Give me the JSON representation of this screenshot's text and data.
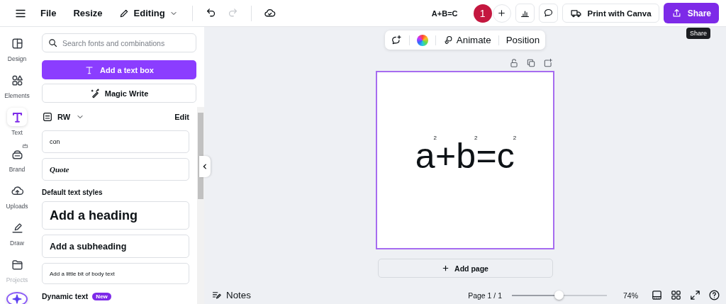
{
  "top_bar": {
    "menu_items": [
      {
        "label": "File"
      },
      {
        "label": "Resize"
      }
    ],
    "mode": "Editing",
    "undo": {
      "disabled": false
    },
    "redo": {
      "disabled": true
    },
    "title": "A+B=C",
    "avatar": "1",
    "print_button": "Print with Canva",
    "share_button": "Share",
    "tooltip": "Share"
  },
  "rail": [
    {
      "label": "Design",
      "kind": "design",
      "selected": false,
      "disabled": false
    },
    {
      "label": "Elements",
      "kind": "elements",
      "selected": false,
      "disabled": false
    },
    {
      "label": "Text",
      "kind": "text",
      "selected": true,
      "disabled": false
    },
    {
      "label": "Brand",
      "kind": "brand",
      "selected": false,
      "disabled": false
    },
    {
      "label": "Uploads",
      "kind": "uploads",
      "selected": false,
      "disabled": false
    },
    {
      "label": "Draw",
      "kind": "draw",
      "selected": false,
      "disabled": false
    },
    {
      "label": "Projects",
      "kind": "projects",
      "selected": false,
      "disabled": true
    }
  ],
  "panel": {
    "search": {
      "placeholder": "Search fonts and combinations"
    },
    "add_text_button": "Add a text box",
    "magic_write_button": "Magic Write",
    "brand_kit": {
      "name": "RW",
      "edit": "Edit"
    },
    "font_samples": [
      {
        "text": "con",
        "kind": "plain"
      },
      {
        "text": "Quote",
        "kind": "script"
      }
    ],
    "default_styles_title": "Default text styles",
    "text_styles": [
      {
        "text": "Add a heading",
        "kind": "heading"
      },
      {
        "text": "Add a subheading",
        "kind": "subheading"
      },
      {
        "text": "Add a little bit of body text",
        "kind": "body"
      }
    ],
    "dynamic_text": {
      "title": "Dynamic text",
      "badge": "New"
    }
  },
  "context_toolbar": {
    "animate": "Animate",
    "position": "Position"
  },
  "canvas": {
    "text": "a$^{2}$+b$^{2}$=c$^{2}$",
    "selected": true
  },
  "add_page_button": "Add page",
  "footer": {
    "notes": "Notes",
    "page": "Page 1 / 1",
    "zoom": {
      "level": 0.5,
      "reading": "74%"
    }
  }
}
